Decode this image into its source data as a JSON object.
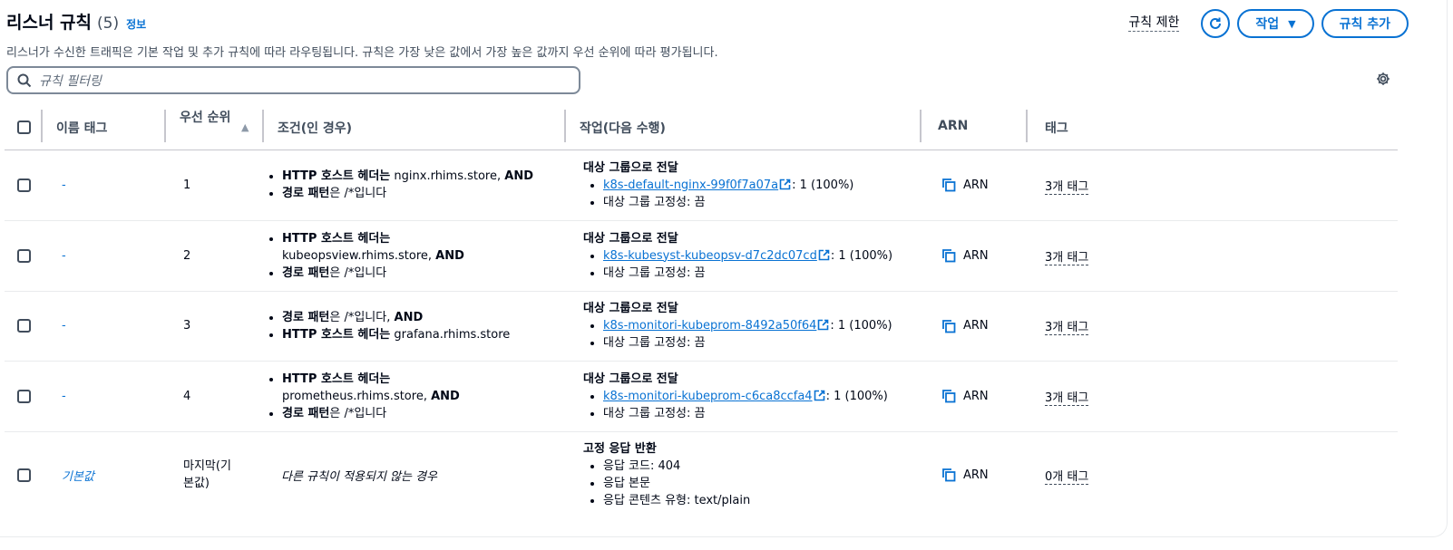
{
  "header": {
    "title": "리스너 규칙",
    "count": "(5)",
    "info_label": "정보",
    "subtitle": "리스너가 수신한 트래픽은 기본 작업 및 추가 규칙에 따라 라우팅됩니다. 규칙은 가장 낮은 값에서 가장 높은 값까지 우선 순위에 따라 평가됩니다.",
    "limit_label": "규칙 제한",
    "actions_label": "작업",
    "add_rule_label": "규칙 추가"
  },
  "search": {
    "placeholder": "규칙 필터링"
  },
  "columns": {
    "name_tag": "이름 태그",
    "priority": "우선 순위",
    "conditions": "조건(인 경우)",
    "actions": "작업(다음 수행)",
    "arn": "ARN",
    "tags": "태그"
  },
  "rows": [
    {
      "name": "-",
      "priority": "1",
      "cond1_bold": "HTTP 호스트 헤더는",
      "cond1_rest": "nginx.rhims.store,",
      "cond1_and": "AND",
      "cond2_bold": "경로 패턴",
      "cond2_rest": "은 /*입니다",
      "action_title": "대상 그룹으로 전달",
      "tg_name": "k8s-default-nginx-99f0f7a07a",
      "tg_weight": ": 1 (100%)",
      "stickiness": "대상 그룹 고정성: 끔",
      "arn_label": "ARN",
      "tags_label": "3개 태그"
    },
    {
      "name": "-",
      "priority": "2",
      "cond1_bold": "HTTP 호스트 헤더는",
      "cond1_rest": "kubeopsview.rhims.store,",
      "cond1_and": "AND",
      "cond2_bold": "경로 패턴",
      "cond2_rest": "은 /*입니다",
      "action_title": "대상 그룹으로 전달",
      "tg_name": "k8s-kubesyst-kubeopsv-d7c2dc07cd",
      "tg_weight": ": 1 (100%)",
      "stickiness": "대상 그룹 고정성: 끔",
      "arn_label": "ARN",
      "tags_label": "3개 태그"
    },
    {
      "name": "-",
      "priority": "3",
      "cond1_bold": "경로 패턴",
      "cond1_rest": "은 /*입니다,",
      "cond1_and": "AND",
      "cond2_bold": "HTTP 호스트 헤더는",
      "cond2_rest": "grafana.rhims.store",
      "action_title": "대상 그룹으로 전달",
      "tg_name": "k8s-monitori-kubeprom-8492a50f64",
      "tg_weight": ": 1 (100%)",
      "stickiness": "대상 그룹 고정성: 끔",
      "arn_label": "ARN",
      "tags_label": "3개 태그"
    },
    {
      "name": "-",
      "priority": "4",
      "cond1_bold": "HTTP 호스트 헤더는",
      "cond1_rest": "prometheus.rhims.store,",
      "cond1_and": "AND",
      "cond2_bold": "경로 패턴",
      "cond2_rest": "은 /*입니다",
      "action_title": "대상 그룹으로 전달",
      "tg_name": "k8s-monitori-kubeprom-c6ca8ccfa4",
      "tg_weight": ": 1 (100%)",
      "stickiness": "대상 그룹 고정성: 끔",
      "arn_label": "ARN",
      "tags_label": "3개 태그"
    }
  ],
  "default_row": {
    "name": "기본값",
    "priority": "마지막(기본값)",
    "condition": "다른 규칙이 적용되지 않는 경우",
    "action_title": "고정 응답 반환",
    "items": [
      "응답 코드: 404",
      "응답 본문",
      "응답 콘텐츠 유형: text/plain"
    ],
    "arn_label": "ARN",
    "tags_label": "0개 태그"
  },
  "colors": {
    "link": "#0972d3",
    "text": "#000716",
    "muted": "#414d5c",
    "border": "#c6c6cd"
  },
  "icons": [
    "search-icon",
    "refresh-icon",
    "caret-down-icon",
    "gear-icon",
    "sort-ascending-icon",
    "external-link-icon",
    "copy-icon"
  ]
}
